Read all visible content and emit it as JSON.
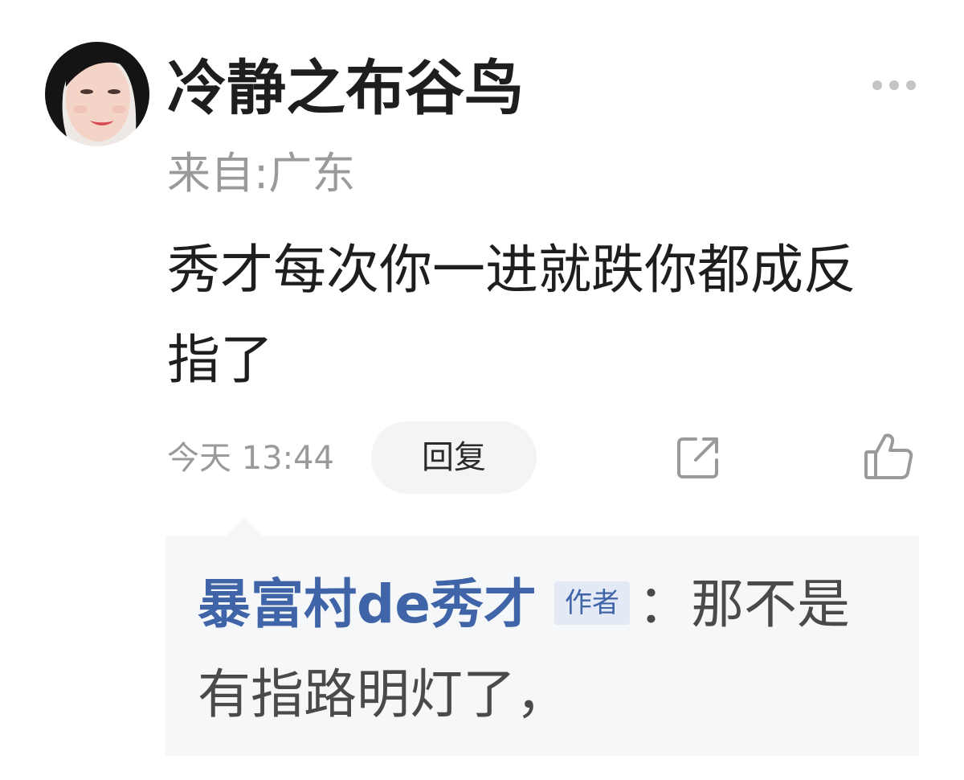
{
  "comment": {
    "username": "冷静之布谷鸟",
    "location": "来自:广东",
    "text": "秀才每次你一进就跌你都成反指了",
    "timestamp": "今天 13:44",
    "reply_label": "回复"
  },
  "reply": {
    "author": "暴富村de秀才",
    "badge": "作者",
    "text": "：那不是有指路明灯了，"
  },
  "icons": {
    "more": "more-icon",
    "share": "share-icon",
    "like": "thumbs-up-icon"
  },
  "colors": {
    "username": "#1e1e1e",
    "muted": "#9a9a9a",
    "reply_author": "#3f64a8",
    "reply_box_bg": "#f6f7f8",
    "badge_bg": "#e3eaf5"
  }
}
